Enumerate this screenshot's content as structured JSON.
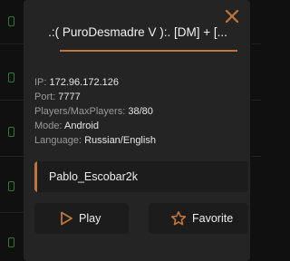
{
  "dialog": {
    "title": ".:( PuroDesmadre V ):.  [DM] + [...",
    "info": [
      {
        "key": "IP:",
        "value": "172.96.172.126"
      },
      {
        "key": "Port:",
        "value": "7777"
      },
      {
        "key": "Players/MaxPlayers:",
        "value": "38/80"
      },
      {
        "key": "Mode:",
        "value": "Android"
      },
      {
        "key": "Language:",
        "value": "Russian/English"
      }
    ],
    "nickname": "Pablo_Escobar2k",
    "play_label": "Play",
    "favorite_label": "Favorite",
    "close_icon": "close-icon",
    "play_icon": "play-icon",
    "favorite_icon": "star-icon"
  },
  "colors": {
    "accent": "#c0763a",
    "background": "#242424",
    "panel": "#1c1c1c"
  }
}
